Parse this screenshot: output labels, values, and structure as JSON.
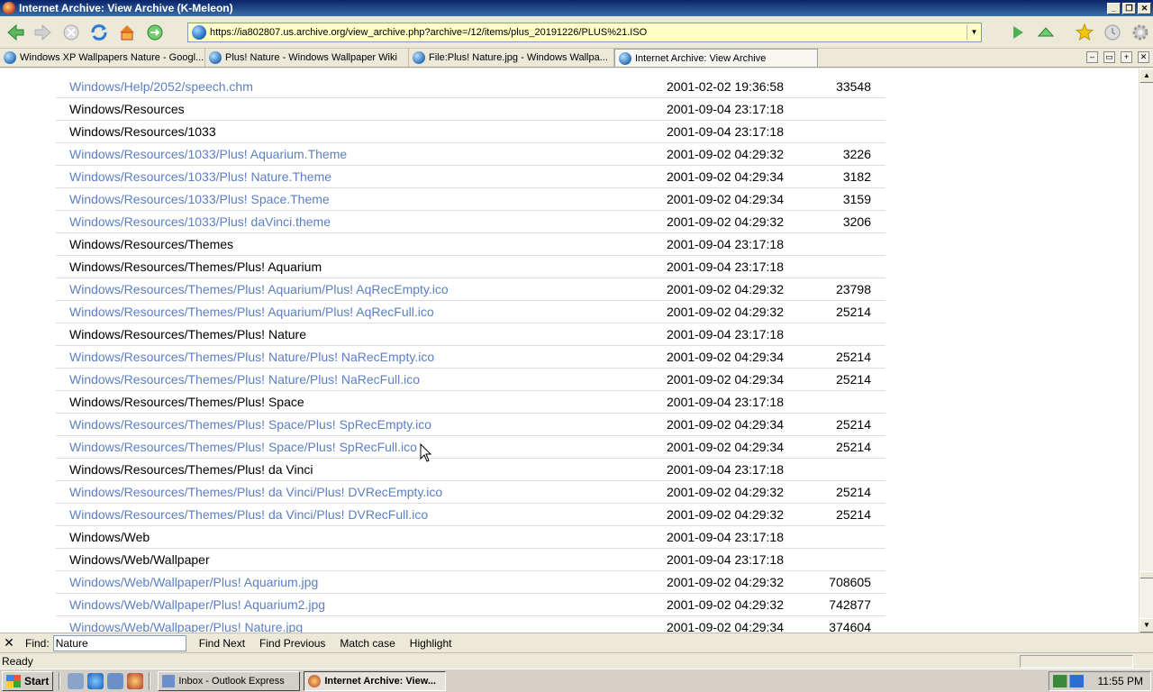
{
  "window": {
    "title": "Internet Archive: View Archive (K-Meleon)"
  },
  "toolbar": {
    "url": "https://ia802807.us.archive.org/view_archive.php?archive=/12/items/plus_20191226/PLUS%21.ISO"
  },
  "tabs": [
    {
      "label": "Windows XP Wallpapers Nature - Googl...",
      "active": false
    },
    {
      "label": "Plus! Nature - Windows Wallpaper Wiki",
      "active": false
    },
    {
      "label": "File:Plus! Nature.jpg - Windows Wallpa...",
      "active": false
    },
    {
      "label": "Internet Archive: View Archive",
      "active": true
    }
  ],
  "rows": [
    {
      "name": "Windows/Help/2052/speech.chm",
      "date": "2001-02-02 19:36:58",
      "size": "33548",
      "link": true
    },
    {
      "name": "Windows/Resources",
      "date": "2001-09-04 23:17:18",
      "size": "",
      "link": false
    },
    {
      "name": "Windows/Resources/1033",
      "date": "2001-09-04 23:17:18",
      "size": "",
      "link": false
    },
    {
      "name": "Windows/Resources/1033/Plus! Aquarium.Theme",
      "date": "2001-09-02 04:29:32",
      "size": "3226",
      "link": true
    },
    {
      "name": "Windows/Resources/1033/Plus! Nature.Theme",
      "date": "2001-09-02 04:29:34",
      "size": "3182",
      "link": true
    },
    {
      "name": "Windows/Resources/1033/Plus! Space.Theme",
      "date": "2001-09-02 04:29:34",
      "size": "3159",
      "link": true
    },
    {
      "name": "Windows/Resources/1033/Plus! daVinci.theme",
      "date": "2001-09-02 04:29:32",
      "size": "3206",
      "link": true
    },
    {
      "name": "Windows/Resources/Themes",
      "date": "2001-09-04 23:17:18",
      "size": "",
      "link": false
    },
    {
      "name": "Windows/Resources/Themes/Plus! Aquarium",
      "date": "2001-09-04 23:17:18",
      "size": "",
      "link": false
    },
    {
      "name": "Windows/Resources/Themes/Plus! Aquarium/Plus! AqRecEmpty.ico",
      "date": "2001-09-02 04:29:32",
      "size": "23798",
      "link": true
    },
    {
      "name": "Windows/Resources/Themes/Plus! Aquarium/Plus! AqRecFull.ico",
      "date": "2001-09-02 04:29:32",
      "size": "25214",
      "link": true
    },
    {
      "name": "Windows/Resources/Themes/Plus! Nature",
      "date": "2001-09-04 23:17:18",
      "size": "",
      "link": false
    },
    {
      "name": "Windows/Resources/Themes/Plus! Nature/Plus! NaRecEmpty.ico",
      "date": "2001-09-02 04:29:34",
      "size": "25214",
      "link": true
    },
    {
      "name": "Windows/Resources/Themes/Plus! Nature/Plus! NaRecFull.ico",
      "date": "2001-09-02 04:29:34",
      "size": "25214",
      "link": true
    },
    {
      "name": "Windows/Resources/Themes/Plus! Space",
      "date": "2001-09-04 23:17:18",
      "size": "",
      "link": false
    },
    {
      "name": "Windows/Resources/Themes/Plus! Space/Plus! SpRecEmpty.ico",
      "date": "2001-09-02 04:29:34",
      "size": "25214",
      "link": true
    },
    {
      "name": "Windows/Resources/Themes/Plus! Space/Plus! SpRecFull.ico",
      "date": "2001-09-02 04:29:34",
      "size": "25214",
      "link": true
    },
    {
      "name": "Windows/Resources/Themes/Plus! da Vinci",
      "date": "2001-09-04 23:17:18",
      "size": "",
      "link": false
    },
    {
      "name": "Windows/Resources/Themes/Plus! da Vinci/Plus! DVRecEmpty.ico",
      "date": "2001-09-02 04:29:32",
      "size": "25214",
      "link": true
    },
    {
      "name": "Windows/Resources/Themes/Plus! da Vinci/Plus! DVRecFull.ico",
      "date": "2001-09-02 04:29:32",
      "size": "25214",
      "link": true
    },
    {
      "name": "Windows/Web",
      "date": "2001-09-04 23:17:18",
      "size": "",
      "link": false
    },
    {
      "name": "Windows/Web/Wallpaper",
      "date": "2001-09-04 23:17:18",
      "size": "",
      "link": false
    },
    {
      "name": "Windows/Web/Wallpaper/Plus! Aquarium.jpg",
      "date": "2001-09-02 04:29:32",
      "size": "708605",
      "link": true
    },
    {
      "name": "Windows/Web/Wallpaper/Plus! Aquarium2.jpg",
      "date": "2001-09-02 04:29:32",
      "size": "742877",
      "link": true
    },
    {
      "name": "Windows/Web/Wallpaper/Plus! Nature.jpg",
      "date": "2001-09-02 04:29:34",
      "size": "374604",
      "link": true
    }
  ],
  "findbar": {
    "label": "Find:",
    "value": "Nature",
    "find_next": "Find Next",
    "find_previous": "Find Previous",
    "match_case": "Match case",
    "highlight": "Highlight"
  },
  "status": {
    "text": "Ready"
  },
  "taskbar": {
    "start": "Start",
    "tasks": [
      {
        "label": "Inbox - Outlook Express",
        "active": false
      },
      {
        "label": "Internet Archive: View...",
        "active": true
      }
    ],
    "clock": "11:55 PM"
  },
  "colors": {
    "link": "#5b7fc2",
    "url_bg": "#ffffc4",
    "titlebar": "#0a246a"
  }
}
